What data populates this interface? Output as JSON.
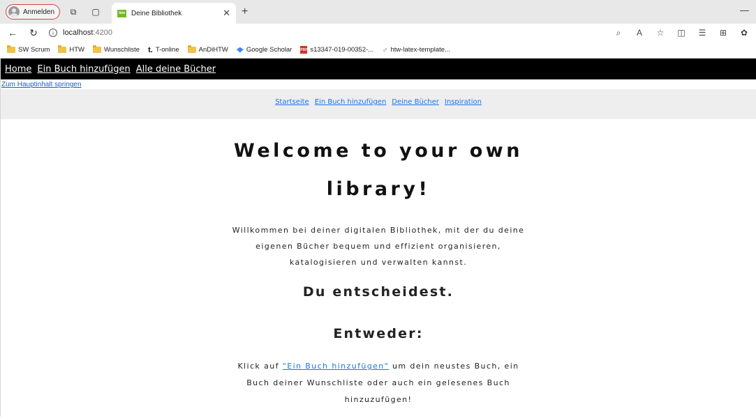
{
  "browser": {
    "profile_label": "Anmelden",
    "tab_title": "Deine Bibliothek",
    "url_host": "localhost",
    "url_port": ":4200",
    "bookmarks": [
      "SW Scrum",
      "HTW",
      "Wunschliste",
      "T-online",
      "AnDiHTW",
      "Google Scholar",
      "s13347-019-00352-...",
      "htw-latex-template..."
    ]
  },
  "topnav": {
    "items": [
      "Home",
      "Ein Buch hinzufügen",
      "Alle deine Bücher"
    ]
  },
  "skip_link": "Zum Hauptinhalt springen",
  "subnav": {
    "items": [
      "Startseite",
      "Ein Buch hinzufügen",
      "Deine Bücher",
      "Inspiration"
    ]
  },
  "main": {
    "welcome_line1": "Welcome to your own",
    "welcome_line2": "library!",
    "intro": "Willkommen bei deiner digitalen Bibliothek, mit der du deine eigenen Bücher bequem und effizient organisieren, katalogisieren und verwalten kannst.",
    "heading_decide": "Du entscheidest.",
    "heading_either": "Entweder:",
    "click_prefix": "Klick auf ",
    "click_link": "\"Ein Buch hinzufügen\"",
    "click_suffix": " um dein neustes Buch, ein Buch deiner Wunschliste oder auch ein gelesenes Buch hinzuzufügen!"
  }
}
